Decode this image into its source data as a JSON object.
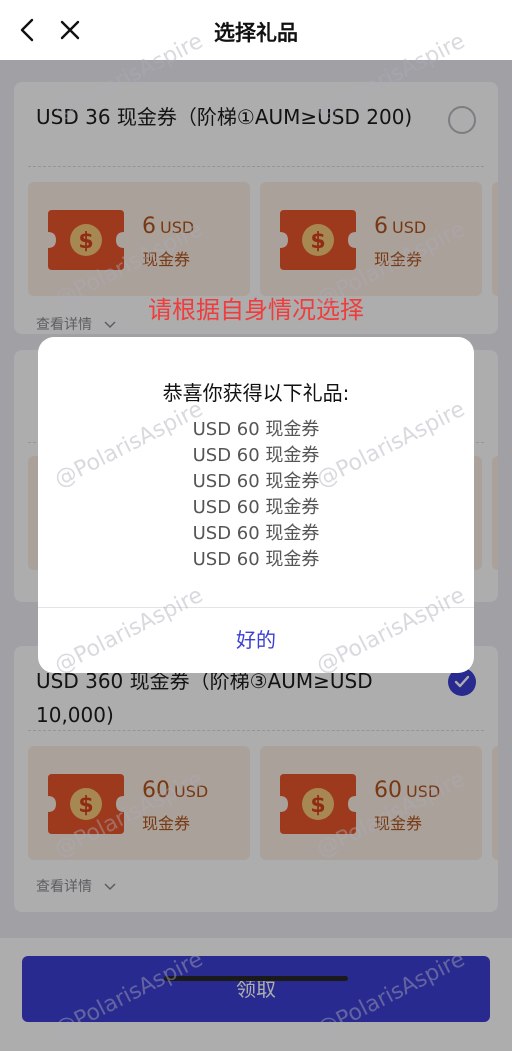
{
  "nav": {
    "title": "选择礼品",
    "back_icon": "chevron-left-icon",
    "close_icon": "close-icon"
  },
  "cards": [
    {
      "title": "USD 36 现金券（阶梯①AUM≥USD 200)",
      "selected": false,
      "vouchers": [
        {
          "amount": "6",
          "currency": "USD",
          "label": "现金券"
        },
        {
          "amount": "6",
          "currency": "USD",
          "label": "现金券"
        }
      ],
      "details": "查看详情"
    },
    {
      "title": "",
      "selected": false,
      "vouchers": [],
      "details": ""
    },
    {
      "title": "USD 360 现金券（阶梯③AUM≥USD 10,000)",
      "selected": true,
      "vouchers": [
        {
          "amount": "60",
          "currency": "USD",
          "label": "现金券"
        },
        {
          "amount": "60",
          "currency": "USD",
          "label": "现金券"
        }
      ],
      "details": "查看详情"
    }
  ],
  "claim_button": "领取",
  "hint": "请根据自身情况选择",
  "dialog": {
    "title": "恭喜你获得以下礼品:",
    "items": [
      "USD 60 现金券",
      "USD 60 现金券",
      "USD 60 现金券",
      "USD 60 现金券",
      "USD 60 现金券",
      "USD 60 现金券"
    ],
    "ok": "好的"
  },
  "watermark": "@PolarisAspire",
  "colors": {
    "accent": "#3b3fd3",
    "hint": "#f03c3c",
    "voucher_bg": "#fbeee4",
    "ticket": "#e8542a"
  }
}
